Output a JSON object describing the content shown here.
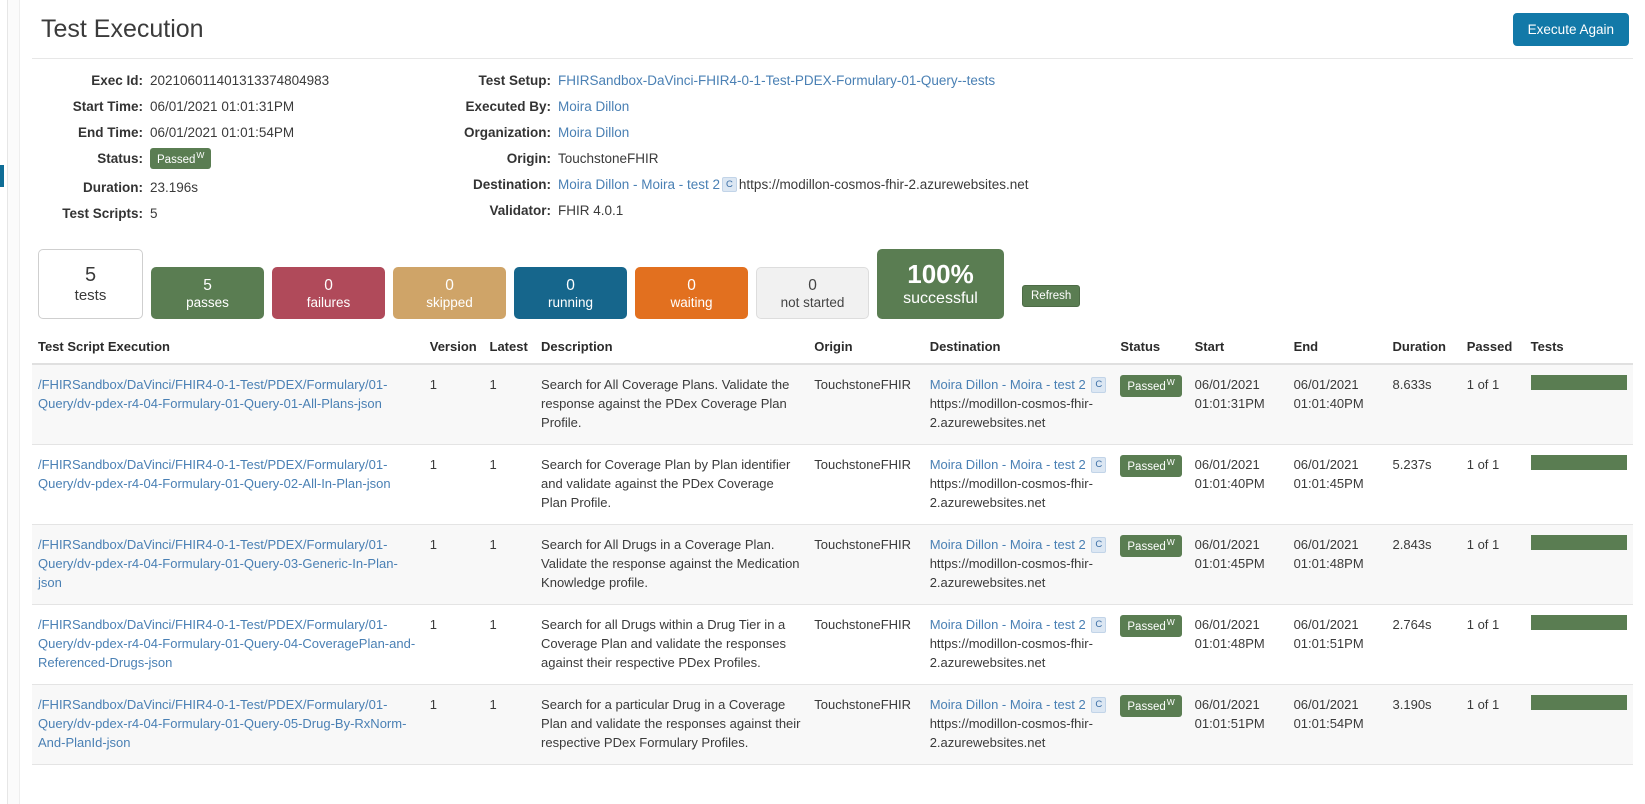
{
  "header": {
    "title": "Test Execution",
    "execute_again_label": "Execute Again"
  },
  "summary": {
    "left": [
      {
        "label": "Exec Id:",
        "value": "202106011401313374804983",
        "type": "text"
      },
      {
        "label": "Start Time:",
        "value": "06/01/2021 01:01:31PM",
        "type": "text"
      },
      {
        "label": "End Time:",
        "value": "06/01/2021 01:01:54PM",
        "type": "text"
      },
      {
        "label": "Status:",
        "value": "Passed",
        "sup": "W",
        "type": "badge"
      },
      {
        "label": "Duration:",
        "value": "23.196s",
        "type": "text"
      },
      {
        "label": "Test Scripts:",
        "value": "5",
        "type": "text"
      }
    ],
    "right": [
      {
        "label": "Test Setup:",
        "value": "FHIRSandbox-DaVinci-FHIR4-0-1-Test-PDEX-Formulary-01-Query--tests",
        "type": "link"
      },
      {
        "label": "Executed By:",
        "value": "Moira Dillon",
        "type": "link"
      },
      {
        "label": "Organization:",
        "value": "Moira Dillon",
        "type": "link"
      },
      {
        "label": "Origin:",
        "value": "TouchstoneFHIR",
        "type": "text"
      },
      {
        "label": "Destination:",
        "value": "Moira Dillon - Moira - test 2",
        "chip": "C",
        "url": "https://modillon-cosmos-fhir-2.azurewebsites.net",
        "type": "destination"
      },
      {
        "label": "Validator:",
        "value": "FHIR 4.0.1",
        "type": "text"
      }
    ]
  },
  "tiles": [
    {
      "name": "tests",
      "num": "5",
      "cap": "tests",
      "color": "#ffffff"
    },
    {
      "name": "passes",
      "num": "5",
      "cap": "passes",
      "color": "#5a7d52"
    },
    {
      "name": "failures",
      "num": "0",
      "cap": "failures",
      "color": "#b04a5a"
    },
    {
      "name": "skipped",
      "num": "0",
      "cap": "skipped",
      "color": "#cfa468"
    },
    {
      "name": "running",
      "num": "0",
      "cap": "running",
      "color": "#16668c"
    },
    {
      "name": "waiting",
      "num": "0",
      "cap": "waiting",
      "color": "#e2701f"
    },
    {
      "name": "not-started",
      "num": "0",
      "cap": "not started",
      "color": "#f1f1f1"
    },
    {
      "name": "successful",
      "num": "100%",
      "cap": "successful",
      "color": "#5a7d52"
    }
  ],
  "refresh_label": "Refresh",
  "table": {
    "columns": [
      "Test Script Execution",
      "Version",
      "Latest",
      "Description",
      "Origin",
      "Destination",
      "Status",
      "Start",
      "End",
      "Duration",
      "Passed",
      "Tests"
    ],
    "rows": [
      {
        "script": "/FHIRSandbox/DaVinci/FHIR4-0-1-Test/PDEX/Formulary/01-Query/dv-pdex-r4-04-Formulary-01-Query-01-All-Plans-json",
        "version": "1",
        "latest": "1",
        "description": "Search for All Coverage Plans. Validate the response against the PDex Coverage Plan Profile.",
        "origin": "TouchstoneFHIR",
        "dest_name": "Moira Dillon - Moira - test 2",
        "dest_chip": "C",
        "dest_url": "https://modillon-cosmos-fhir-2.azurewebsites.net",
        "status": "Passed",
        "status_sup": "W",
        "start_date": "06/01/2021",
        "start_time": "01:01:31PM",
        "end_date": "06/01/2021",
        "end_time": "01:01:40PM",
        "duration": "8.633s",
        "passed": "1 of 1",
        "tests_pct": 100
      },
      {
        "script": "/FHIRSandbox/DaVinci/FHIR4-0-1-Test/PDEX/Formulary/01-Query/dv-pdex-r4-04-Formulary-01-Query-02-All-In-Plan-json",
        "version": "1",
        "latest": "1",
        "description": "Search for Coverage Plan by Plan identifier and validate against the PDex Coverage Plan Profile.",
        "origin": "TouchstoneFHIR",
        "dest_name": "Moira Dillon - Moira - test 2",
        "dest_chip": "C",
        "dest_url": "https://modillon-cosmos-fhir-2.azurewebsites.net",
        "status": "Passed",
        "status_sup": "W",
        "start_date": "06/01/2021",
        "start_time": "01:01:40PM",
        "end_date": "06/01/2021",
        "end_time": "01:01:45PM",
        "duration": "5.237s",
        "passed": "1 of 1",
        "tests_pct": 100
      },
      {
        "script": "/FHIRSandbox/DaVinci/FHIR4-0-1-Test/PDEX/Formulary/01-Query/dv-pdex-r4-04-Formulary-01-Query-03-Generic-In-Plan-json",
        "version": "1",
        "latest": "1",
        "description": "Search for All Drugs in a Coverage Plan. Validate the response against the Medication Knowledge profile.",
        "origin": "TouchstoneFHIR",
        "dest_name": "Moira Dillon - Moira - test 2",
        "dest_chip": "C",
        "dest_url": "https://modillon-cosmos-fhir-2.azurewebsites.net",
        "status": "Passed",
        "status_sup": "W",
        "start_date": "06/01/2021",
        "start_time": "01:01:45PM",
        "end_date": "06/01/2021",
        "end_time": "01:01:48PM",
        "duration": "2.843s",
        "passed": "1 of 1",
        "tests_pct": 100
      },
      {
        "script": "/FHIRSandbox/DaVinci/FHIR4-0-1-Test/PDEX/Formulary/01-Query/dv-pdex-r4-04-Formulary-01-Query-04-CoveragePlan-and-Referenced-Drugs-json",
        "version": "1",
        "latest": "1",
        "description": "Search for all Drugs within a Drug Tier in a Coverage Plan and validate the responses against their respective PDex Profiles.",
        "origin": "TouchstoneFHIR",
        "dest_name": "Moira Dillon - Moira - test 2",
        "dest_chip": "C",
        "dest_url": "https://modillon-cosmos-fhir-2.azurewebsites.net",
        "status": "Passed",
        "status_sup": "W",
        "start_date": "06/01/2021",
        "start_time": "01:01:48PM",
        "end_date": "06/01/2021",
        "end_time": "01:01:51PM",
        "duration": "2.764s",
        "passed": "1 of 1",
        "tests_pct": 100
      },
      {
        "script": "/FHIRSandbox/DaVinci/FHIR4-0-1-Test/PDEX/Formulary/01-Query/dv-pdex-r4-04-Formulary-01-Query-05-Drug-By-RxNorm-And-PlanId-json",
        "version": "1",
        "latest": "1",
        "description": "Search for a particular Drug in a Coverage Plan and validate the responses against their respective PDex Formulary Profiles.",
        "origin": "TouchstoneFHIR",
        "dest_name": "Moira Dillon - Moira - test 2",
        "dest_chip": "C",
        "dest_url": "https://modillon-cosmos-fhir-2.azurewebsites.net",
        "status": "Passed",
        "status_sup": "W",
        "start_date": "06/01/2021",
        "start_time": "01:01:51PM",
        "end_date": "06/01/2021",
        "end_time": "01:01:54PM",
        "duration": "3.190s",
        "passed": "1 of 1",
        "tests_pct": 100
      }
    ]
  },
  "colors": {
    "accent_blue": "#1279a8",
    "pass_green": "#5a7d52",
    "fail_red": "#b04a5a",
    "skip_tan": "#cfa468",
    "running_blue": "#16668c",
    "waiting_orange": "#e2701f",
    "link_blue": "#4a80b4"
  }
}
